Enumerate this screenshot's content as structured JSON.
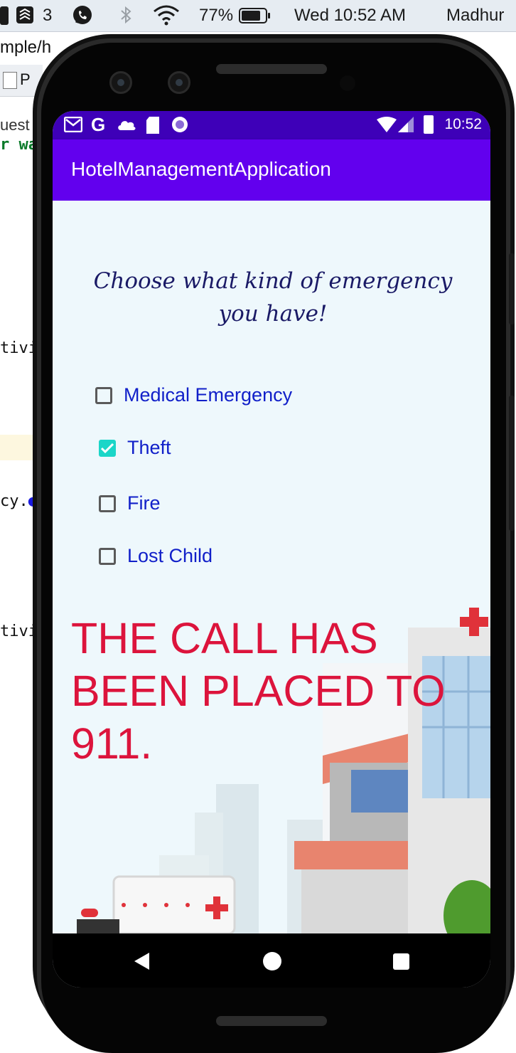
{
  "mac_menubar": {
    "badge_count": "3",
    "battery_percent": "77%",
    "clock": "Wed 10:52 AM",
    "user": "Madhur"
  },
  "ide": {
    "lines": [
      "mple/h",
      "P",
      "uest",
      "r wa",
      "tivi",
      "cy.",
      "tivi"
    ]
  },
  "android_status": {
    "time": "10:52"
  },
  "app": {
    "title": "HotelManagementApplication",
    "prompt": "Choose what kind of emergency you have!",
    "options": [
      {
        "label": "Medical Emergency",
        "checked": false
      },
      {
        "label": "Theft",
        "checked": true
      },
      {
        "label": "Fire",
        "checked": false
      },
      {
        "label": "Lost Child",
        "checked": false
      }
    ],
    "result_message": "THE CALL HAS BEEN PLACED TO 911."
  },
  "colors": {
    "app_bar": "#6200ee",
    "status_bar": "#3e00b8",
    "checkbox_checked": "#1bd6c8",
    "option_text": "#1120c9",
    "result_text": "#dc143c"
  },
  "nav": {
    "back_icon": "back-triangle-icon",
    "home_icon": "home-circle-icon",
    "recents_icon": "recents-square-icon"
  }
}
